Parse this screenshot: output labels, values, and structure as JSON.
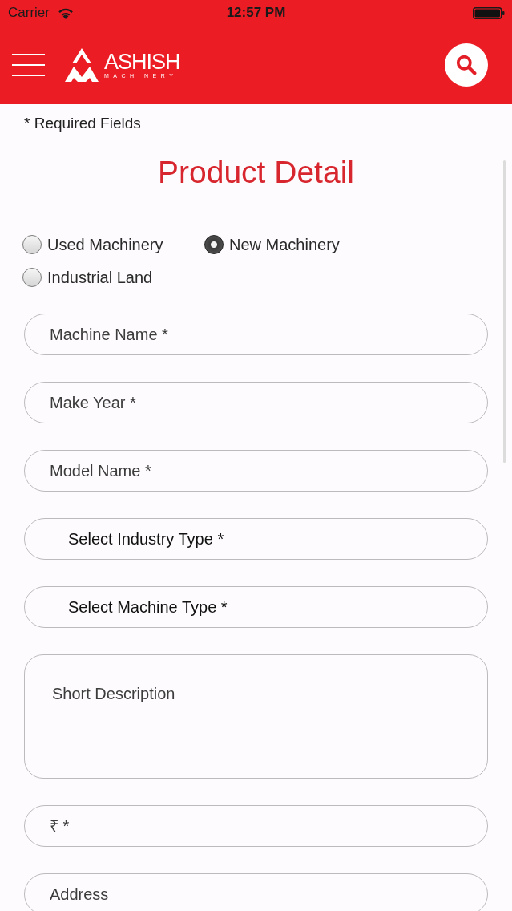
{
  "status_bar": {
    "carrier": "Carrier",
    "time": "12:57 PM"
  },
  "header": {
    "logo": {
      "name": "ASHISH",
      "tagline": "MACHINERY"
    }
  },
  "required_note": "* Required Fields",
  "title": "Product Detail",
  "category_options": [
    {
      "label": "Used Machinery",
      "selected": false
    },
    {
      "label": "New Machinery",
      "selected": true
    },
    {
      "label": "Industrial Land",
      "selected": false
    }
  ],
  "fields": [
    {
      "kind": "text",
      "placeholder": "Machine Name *"
    },
    {
      "kind": "text",
      "placeholder": "Make Year *"
    },
    {
      "kind": "text",
      "placeholder": "Model Name *"
    },
    {
      "kind": "select",
      "placeholder": "Select Industry Type *"
    },
    {
      "kind": "select",
      "placeholder": "Select Machine Type *"
    },
    {
      "kind": "textarea",
      "placeholder": "Short Description"
    },
    {
      "kind": "text",
      "placeholder": "₹ *"
    },
    {
      "kind": "text",
      "placeholder": "Address"
    }
  ]
}
